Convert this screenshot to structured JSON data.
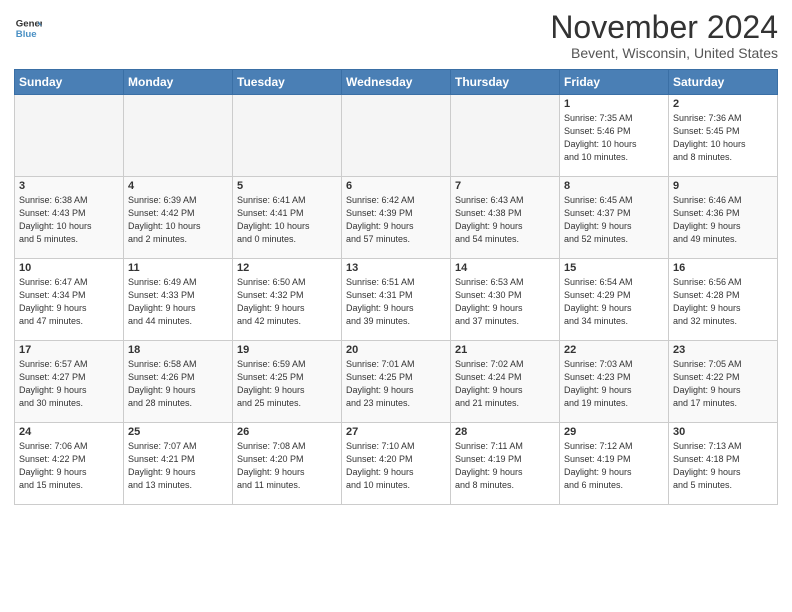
{
  "logo": {
    "line1": "General",
    "line2": "Blue"
  },
  "title": "November 2024",
  "location": "Bevent, Wisconsin, United States",
  "days_of_week": [
    "Sunday",
    "Monday",
    "Tuesday",
    "Wednesday",
    "Thursday",
    "Friday",
    "Saturday"
  ],
  "weeks": [
    [
      {
        "day": "",
        "info": ""
      },
      {
        "day": "",
        "info": ""
      },
      {
        "day": "",
        "info": ""
      },
      {
        "day": "",
        "info": ""
      },
      {
        "day": "",
        "info": ""
      },
      {
        "day": "1",
        "info": "Sunrise: 7:35 AM\nSunset: 5:46 PM\nDaylight: 10 hours\nand 10 minutes."
      },
      {
        "day": "2",
        "info": "Sunrise: 7:36 AM\nSunset: 5:45 PM\nDaylight: 10 hours\nand 8 minutes."
      }
    ],
    [
      {
        "day": "3",
        "info": "Sunrise: 6:38 AM\nSunset: 4:43 PM\nDaylight: 10 hours\nand 5 minutes."
      },
      {
        "day": "4",
        "info": "Sunrise: 6:39 AM\nSunset: 4:42 PM\nDaylight: 10 hours\nand 2 minutes."
      },
      {
        "day": "5",
        "info": "Sunrise: 6:41 AM\nSunset: 4:41 PM\nDaylight: 10 hours\nand 0 minutes."
      },
      {
        "day": "6",
        "info": "Sunrise: 6:42 AM\nSunset: 4:39 PM\nDaylight: 9 hours\nand 57 minutes."
      },
      {
        "day": "7",
        "info": "Sunrise: 6:43 AM\nSunset: 4:38 PM\nDaylight: 9 hours\nand 54 minutes."
      },
      {
        "day": "8",
        "info": "Sunrise: 6:45 AM\nSunset: 4:37 PM\nDaylight: 9 hours\nand 52 minutes."
      },
      {
        "day": "9",
        "info": "Sunrise: 6:46 AM\nSunset: 4:36 PM\nDaylight: 9 hours\nand 49 minutes."
      }
    ],
    [
      {
        "day": "10",
        "info": "Sunrise: 6:47 AM\nSunset: 4:34 PM\nDaylight: 9 hours\nand 47 minutes."
      },
      {
        "day": "11",
        "info": "Sunrise: 6:49 AM\nSunset: 4:33 PM\nDaylight: 9 hours\nand 44 minutes."
      },
      {
        "day": "12",
        "info": "Sunrise: 6:50 AM\nSunset: 4:32 PM\nDaylight: 9 hours\nand 42 minutes."
      },
      {
        "day": "13",
        "info": "Sunrise: 6:51 AM\nSunset: 4:31 PM\nDaylight: 9 hours\nand 39 minutes."
      },
      {
        "day": "14",
        "info": "Sunrise: 6:53 AM\nSunset: 4:30 PM\nDaylight: 9 hours\nand 37 minutes."
      },
      {
        "day": "15",
        "info": "Sunrise: 6:54 AM\nSunset: 4:29 PM\nDaylight: 9 hours\nand 34 minutes."
      },
      {
        "day": "16",
        "info": "Sunrise: 6:56 AM\nSunset: 4:28 PM\nDaylight: 9 hours\nand 32 minutes."
      }
    ],
    [
      {
        "day": "17",
        "info": "Sunrise: 6:57 AM\nSunset: 4:27 PM\nDaylight: 9 hours\nand 30 minutes."
      },
      {
        "day": "18",
        "info": "Sunrise: 6:58 AM\nSunset: 4:26 PM\nDaylight: 9 hours\nand 28 minutes."
      },
      {
        "day": "19",
        "info": "Sunrise: 6:59 AM\nSunset: 4:25 PM\nDaylight: 9 hours\nand 25 minutes."
      },
      {
        "day": "20",
        "info": "Sunrise: 7:01 AM\nSunset: 4:25 PM\nDaylight: 9 hours\nand 23 minutes."
      },
      {
        "day": "21",
        "info": "Sunrise: 7:02 AM\nSunset: 4:24 PM\nDaylight: 9 hours\nand 21 minutes."
      },
      {
        "day": "22",
        "info": "Sunrise: 7:03 AM\nSunset: 4:23 PM\nDaylight: 9 hours\nand 19 minutes."
      },
      {
        "day": "23",
        "info": "Sunrise: 7:05 AM\nSunset: 4:22 PM\nDaylight: 9 hours\nand 17 minutes."
      }
    ],
    [
      {
        "day": "24",
        "info": "Sunrise: 7:06 AM\nSunset: 4:22 PM\nDaylight: 9 hours\nand 15 minutes."
      },
      {
        "day": "25",
        "info": "Sunrise: 7:07 AM\nSunset: 4:21 PM\nDaylight: 9 hours\nand 13 minutes."
      },
      {
        "day": "26",
        "info": "Sunrise: 7:08 AM\nSunset: 4:20 PM\nDaylight: 9 hours\nand 11 minutes."
      },
      {
        "day": "27",
        "info": "Sunrise: 7:10 AM\nSunset: 4:20 PM\nDaylight: 9 hours\nand 10 minutes."
      },
      {
        "day": "28",
        "info": "Sunrise: 7:11 AM\nSunset: 4:19 PM\nDaylight: 9 hours\nand 8 minutes."
      },
      {
        "day": "29",
        "info": "Sunrise: 7:12 AM\nSunset: 4:19 PM\nDaylight: 9 hours\nand 6 minutes."
      },
      {
        "day": "30",
        "info": "Sunrise: 7:13 AM\nSunset: 4:18 PM\nDaylight: 9 hours\nand 5 minutes."
      }
    ]
  ]
}
